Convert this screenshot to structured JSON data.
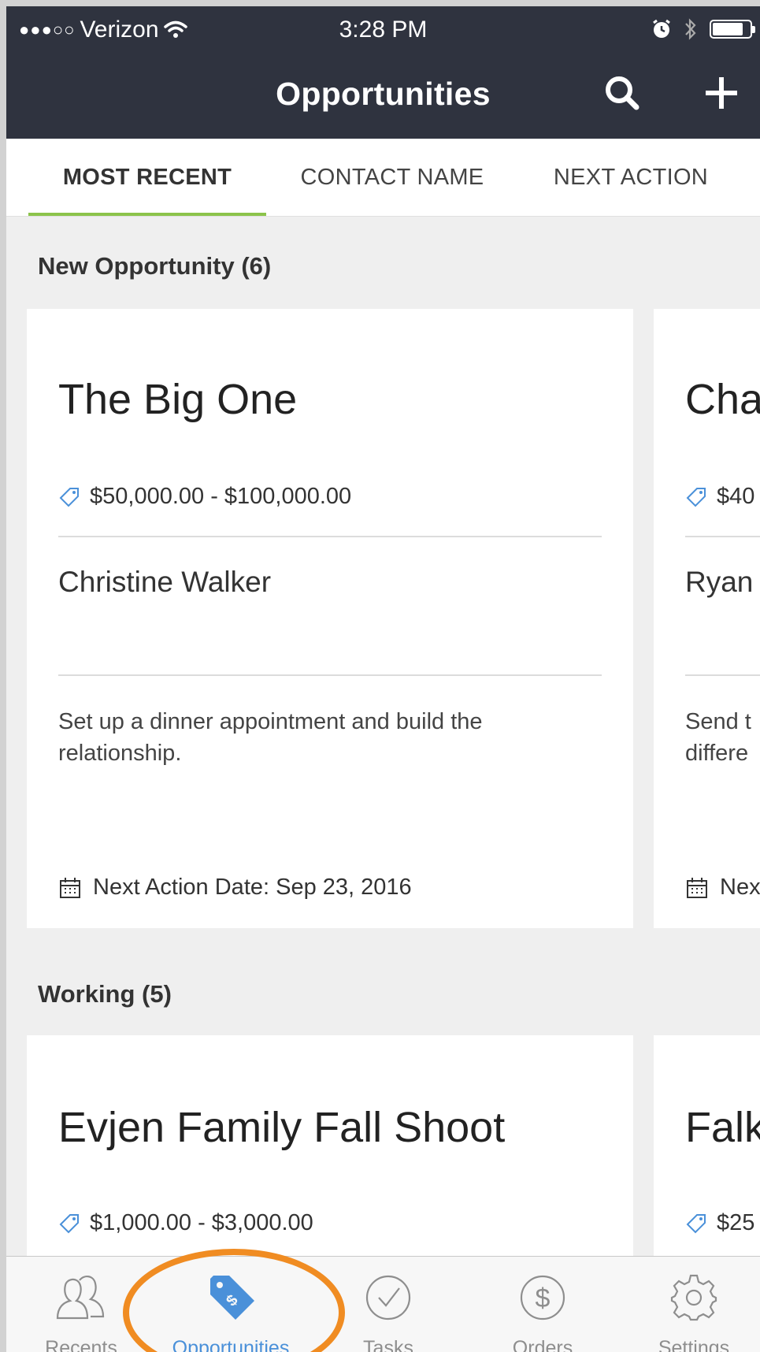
{
  "status_bar": {
    "signal": "●●●○○",
    "carrier": "Verizon",
    "time": "3:28 PM"
  },
  "header": {
    "title": "Opportunities",
    "search_icon": "search-icon",
    "add_icon": "plus-icon"
  },
  "sort_tabs": [
    {
      "label": "MOST RECENT",
      "active": true
    },
    {
      "label": "CONTACT NAME",
      "active": false
    },
    {
      "label": "NEXT ACTION",
      "active": false
    }
  ],
  "sections": [
    {
      "title": "New Opportunity (6)",
      "cards": [
        {
          "name": "The Big One",
          "price": "$50,000.00 - $100,000.00",
          "contact": "Christine Walker",
          "action": "Set up a dinner appointment and build the relationship.",
          "date": "Next Action Date: Sep 23, 2016"
        },
        {
          "name": "Cha",
          "price": "$40",
          "contact": "Ryan",
          "action": "Send t differe",
          "date": "Nex"
        }
      ]
    },
    {
      "title": "Working (5)",
      "cards": [
        {
          "name": "Evjen Family Fall Shoot",
          "price": "$1,000.00 - $3,000.00"
        },
        {
          "name": "Falk",
          "price": "$25"
        }
      ]
    }
  ],
  "tab_bar": [
    {
      "label": "Recents",
      "icon": "people-icon",
      "active": false
    },
    {
      "label": "Opportunities",
      "icon": "price-tag-icon",
      "active": true
    },
    {
      "label": "Tasks",
      "icon": "check-circle-icon",
      "active": false
    },
    {
      "label": "Orders",
      "icon": "dollar-circle-icon",
      "active": false
    },
    {
      "label": "Settings",
      "icon": "gear-icon",
      "active": false
    }
  ],
  "colors": {
    "header_bg": "#2f333f",
    "active_tab_underline": "#8bc34a",
    "active_tabbar": "#4a90d9",
    "annotation_circle": "#f08c22"
  }
}
